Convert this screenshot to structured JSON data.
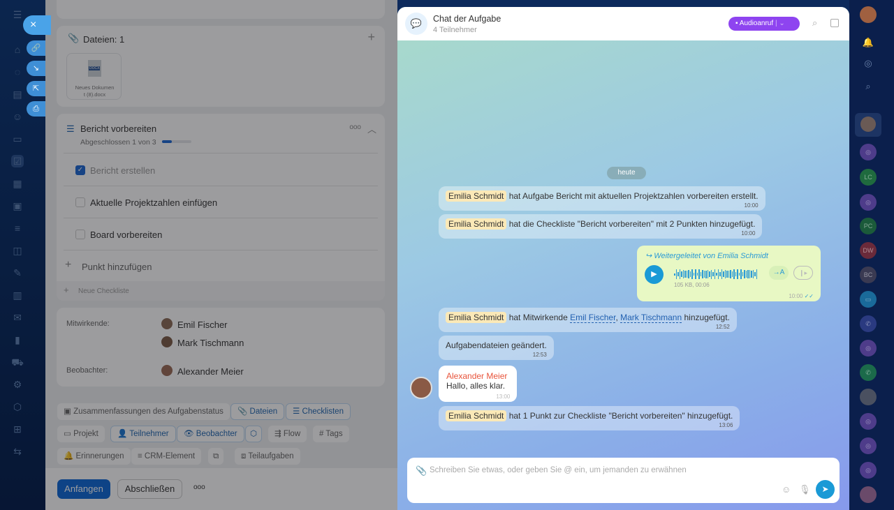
{
  "nav": {
    "close_icon": "×",
    "actions": [
      "link-icon",
      "download-icon",
      "external-icon",
      "print-icon"
    ]
  },
  "files": {
    "title": "Dateien: 1",
    "add": "+",
    "file_name": "Neues Dokument (8).docx",
    "file_line1": "Neues Dokumen",
    "file_line2": "t (8).docx",
    "file_badge": "DOCX"
  },
  "checklist": {
    "title": "Bericht vorbereiten",
    "progress_text": "Abgeschlossen 1 von 3",
    "progress_fraction": 0.333,
    "more": "ooo",
    "items": [
      {
        "label": "Bericht erstellen",
        "checked": true
      },
      {
        "label": "Aktuelle Projektzahlen einfügen",
        "checked": false
      },
      {
        "label": "Board vorbereiten",
        "checked": false
      }
    ],
    "add_item": "Punkt hinzufügen",
    "new_checklist": "Neue Checkliste"
  },
  "people": {
    "contributors_label": "Mitwirkende:",
    "contributors": [
      "Emil Fischer",
      "Mark Tischmann"
    ],
    "observers_label": "Beobachter:",
    "observers": [
      "Alexander Meier"
    ]
  },
  "chips": {
    "summary": "Zusammenfassungen des Aufgabenstatus",
    "files": "Dateien",
    "checklists": "Checklisten",
    "project": "Projekt",
    "participants": "Teilnehmer",
    "observers": "Beobachter",
    "flow": "Flow",
    "tags": "Tags",
    "reminders": "Erinnerungen",
    "crm": "CRM-Element",
    "subtasks": "Teilaufgaben"
  },
  "footer": {
    "start": "Anfangen",
    "finish": "Abschließen",
    "more": "ooo"
  },
  "chat": {
    "title": "Chat der Aufgabe",
    "subtitle": "4 Teilnehmer",
    "call": "Audioanruf",
    "date": "heute",
    "m1": {
      "name": "Emilia Schmidt",
      "text": "hat Aufgabe Bericht mit aktuellen Projektzahlen vorbereiten erstellt.",
      "time": "10:00"
    },
    "m2": {
      "name": "Emilia Schmidt",
      "text": "hat die Checkliste \"Bericht vorbereiten\" mit 2 Punkten hinzugefügt.",
      "time": "10:00"
    },
    "m3": {
      "forward": "Weitergeleitet von Emilia Schmidt",
      "meta": "105 KB, 00:06",
      "transcribe": "→A",
      "time": "10:00"
    },
    "m4": {
      "name": "Emilia Schmidt",
      "pre": "hat Mitwirkende",
      "l1": "Emil Fischer",
      "sep": ",",
      "l2": "Mark Tischmann",
      "post": "hinzugefügt.",
      "time": "12:52"
    },
    "m5": {
      "text": "Aufgabendateien geändert.",
      "time": "12:53"
    },
    "m6": {
      "name": "Alexander Meier",
      "text": "Hallo, alles klar.",
      "time": "13:00"
    },
    "m7": {
      "name": "Emilia Schmidt",
      "text": "hat 1 Punkt zur Checkliste \"Bericht vorbereiten\" hinzugefügt.",
      "time": "13:06"
    },
    "input_placeholder": "Schreiben Sie etwas, oder geben Sie @ ein, um jemanden zu erwähnen"
  },
  "right": {
    "avatars": [
      "LC",
      "PC",
      "DW",
      "BC"
    ]
  },
  "colors": {
    "accent": "#0b66d6",
    "call": "#8e44f0",
    "sender": "#e8533a",
    "voice": "#e8f8c4"
  }
}
